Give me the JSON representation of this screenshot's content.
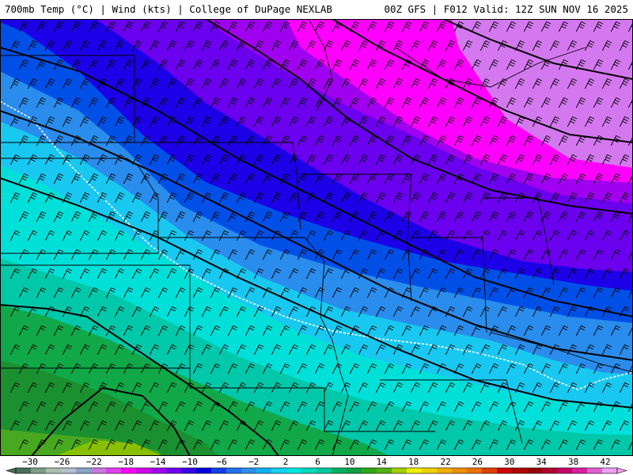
{
  "header": {
    "title_left": "700mb Temp (°C) | Wind (kts) | College of DuPage NEXLAB",
    "title_right": "00Z GFS | F012 Valid: 12Z SUN NOV 16 2025"
  },
  "map": {
    "field": "700mb temperature",
    "units": "°C",
    "wind_units": "kts",
    "freezing_line": "dashed white 0°C contour",
    "band_colors": [
      "#d478f0",
      "#ff00ff",
      "#a000f0",
      "#6a00ee",
      "#1c00e8",
      "#0050e8",
      "#2a8cec",
      "#18c8f0",
      "#00e0d8",
      "#00c8a8",
      "#10a848",
      "#1a9030",
      "#48a820",
      "#88c000"
    ],
    "state_line_color": "#000000",
    "height_contour_color": "#000000"
  },
  "colorbar": {
    "labels": [
      "−30",
      "−26",
      "−22",
      "−18",
      "−14",
      "−10",
      "−6",
      "−2",
      "2",
      "6",
      "10",
      "14",
      "18",
      "22",
      "26",
      "30",
      "34",
      "38",
      "42"
    ],
    "colors": [
      "#4a6e58",
      "#7c9e86",
      "#a8bfb0",
      "#b4c0cc",
      "#8aa4c8",
      "#c878e0",
      "#e040f0",
      "#ff00ff",
      "#d000e8",
      "#a000f0",
      "#7000ee",
      "#3800e8",
      "#0000e0",
      "#1040e8",
      "#2070ec",
      "#2c90ec",
      "#10b0f0",
      "#18d0f0",
      "#00e6e0",
      "#00d8c0",
      "#00c8a0",
      "#00b060",
      "#10a040",
      "#30a818",
      "#50b010",
      "#a0d000",
      "#f0f000",
      "#f0d000",
      "#f0b000",
      "#f09000",
      "#f07000",
      "#e04000",
      "#d00000",
      "#b00000",
      "#980000",
      "#b00030",
      "#c8006c",
      "#d820a0",
      "#e060d0",
      "#f0a0f0"
    ]
  }
}
